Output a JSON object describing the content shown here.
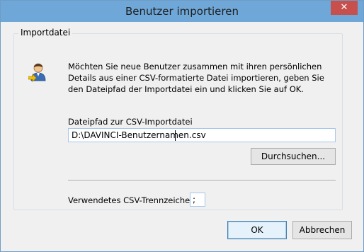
{
  "window": {
    "title": "Benutzer importieren",
    "close_label": "✕"
  },
  "group": {
    "title": "Importdatei",
    "description": "Möchten Sie neue Benutzer zusammen mit ihren persönlichen Details aus einer CSV-formatierte Datei importieren, geben Sie den Dateipfad der Importdatei ein und klicken Sie auf OK.",
    "path_label": "Dateipfad zur CSV-Importdatei",
    "path_value": "D:\\DAVINCI-Benutzernamen.csv",
    "browse_label": "Durchsuchen...",
    "separator_label": "Verwendetes CSV-Trennzeichen",
    "separator_value": ";"
  },
  "buttons": {
    "ok_label": "OK",
    "cancel_label": "Abbrechen"
  },
  "icons": {
    "user": "user-import-icon",
    "close": "close-icon"
  },
  "colors": {
    "titlebar": "#6fa8d8",
    "close": "#c74f4c",
    "focus_border": "#3c7fb1"
  }
}
